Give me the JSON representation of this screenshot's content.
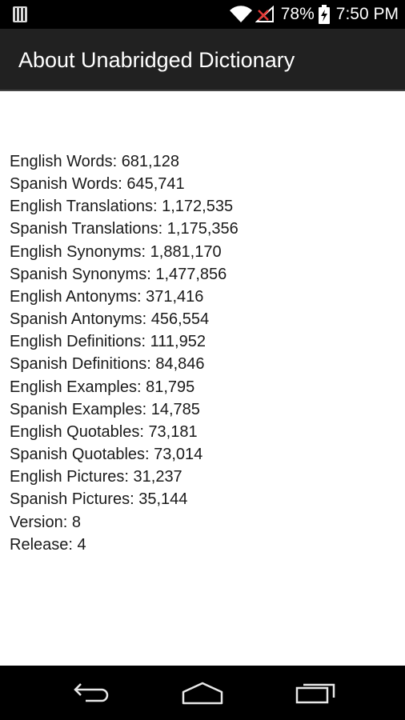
{
  "status_bar": {
    "battery": "78%",
    "time": "7:50 PM"
  },
  "action_bar": {
    "title": "About Unabridged Dictionary"
  },
  "stats": [
    "English Words: 681,128",
    "Spanish Words: 645,741",
    "English Translations: 1,172,535",
    "Spanish Translations: 1,175,356",
    "English Synonyms: 1,881,170",
    "Spanish Synonyms: 1,477,856",
    "English Antonyms: 371,416",
    "Spanish Antonyms: 456,554",
    "English Definitions: 111,952",
    "Spanish Definitions: 84,846",
    "English Examples: 81,795",
    "Spanish Examples: 14,785",
    "English Quotables: 73,181",
    "Spanish Quotables: 73,014",
    "English Pictures: 31,237",
    "Spanish Pictures: 35,144",
    "Version: 8",
    "Release: 4"
  ],
  "nav_bar": {
    "icons": [
      "back-icon",
      "home-icon",
      "recent-apps-icon"
    ]
  }
}
